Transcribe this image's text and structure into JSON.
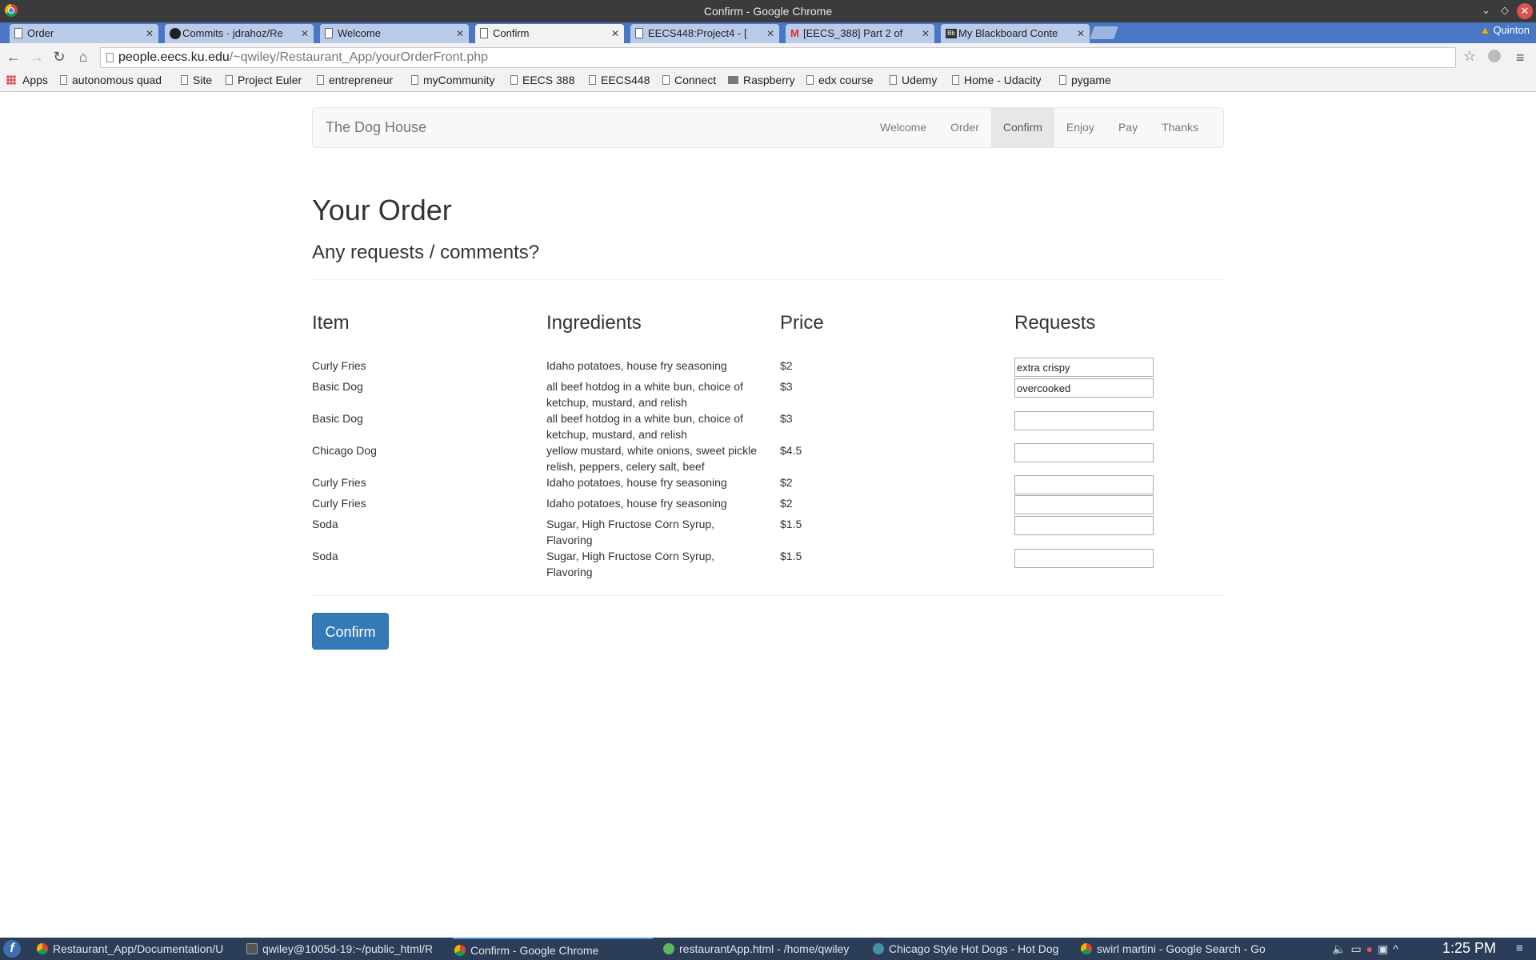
{
  "window": {
    "title": "Confirm - Google Chrome",
    "profile": "Quinton"
  },
  "tabs": [
    {
      "label": "Order",
      "icon": "page-icon",
      "active": false
    },
    {
      "label": "Commits · jdrahoz/Re",
      "icon": "github-icon",
      "active": false
    },
    {
      "label": "Welcome",
      "icon": "page-icon",
      "active": false
    },
    {
      "label": "Confirm",
      "icon": "page-icon",
      "active": true
    },
    {
      "label": "EECS448:Project4 - [",
      "icon": "page-icon",
      "active": false
    },
    {
      "label": "[EECS_388] Part 2 of",
      "icon": "gmail-icon",
      "active": false
    },
    {
      "label": "My Blackboard Conte",
      "icon": "blackboard-icon",
      "active": false
    }
  ],
  "address_bar": {
    "host": "people.eecs.ku.edu",
    "path": "/~qwiley/Restaurant_App/yourOrderFront.php"
  },
  "bookmarks": [
    {
      "label": "Apps",
      "icon": "apps-grid-icon"
    },
    {
      "label": "autonomous quad",
      "icon": "page-icon"
    },
    {
      "label": "Site",
      "icon": "page-icon"
    },
    {
      "label": "Project Euler",
      "icon": "page-icon"
    },
    {
      "label": "entrepreneur",
      "icon": "page-icon"
    },
    {
      "label": "myCommunity",
      "icon": "page-icon"
    },
    {
      "label": "EECS 388",
      "icon": "page-icon"
    },
    {
      "label": "EECS448",
      "icon": "page-icon"
    },
    {
      "label": "Connect",
      "icon": "page-icon"
    },
    {
      "label": "Raspberry",
      "icon": "folder-icon"
    },
    {
      "label": "edx course",
      "icon": "page-icon"
    },
    {
      "label": "Udemy",
      "icon": "page-icon"
    },
    {
      "label": "Home - Udacity",
      "icon": "page-icon"
    },
    {
      "label": "pygame",
      "icon": "page-icon"
    }
  ],
  "site": {
    "brand": "The Dog House",
    "nav": [
      "Welcome",
      "Order",
      "Confirm",
      "Enjoy",
      "Pay",
      "Thanks"
    ],
    "active_nav": "Confirm"
  },
  "page": {
    "title": "Your Order",
    "subtitle": "Any requests / comments?",
    "columns": [
      "Item",
      "Ingredients",
      "Price",
      "Requests"
    ],
    "rows": [
      {
        "item": "Curly Fries",
        "ingredients": "Idaho potatoes, house fry seasoning",
        "price": "$2",
        "request": "extra crispy"
      },
      {
        "item": "Basic Dog",
        "ingredients": "all beef hotdog in a white bun, choice of ketchup, mustard, and relish",
        "price": "$3",
        "request": "overcooked"
      },
      {
        "item": "Basic Dog",
        "ingredients": "all beef hotdog in a white bun, choice of ketchup, mustard, and relish",
        "price": "$3",
        "request": ""
      },
      {
        "item": "Chicago Dog",
        "ingredients": "yellow mustard, white onions, sweet pickle relish, peppers, celery salt, beef",
        "price": "$4.5",
        "request": ""
      },
      {
        "item": "Curly Fries",
        "ingredients": "Idaho potatoes, house fry seasoning",
        "price": "$2",
        "request": ""
      },
      {
        "item": "Curly Fries",
        "ingredients": "Idaho potatoes, house fry seasoning",
        "price": "$2",
        "request": ""
      },
      {
        "item": "Soda",
        "ingredients": "Sugar, High Fructose Corn Syrup, Flavoring",
        "price": "$1.5",
        "request": ""
      },
      {
        "item": "Soda",
        "ingredients": "Sugar, High Fructose Corn Syrup, Flavoring",
        "price": "$1.5",
        "request": ""
      }
    ],
    "confirm_label": "Confirm"
  },
  "taskbar": {
    "tasks": [
      {
        "label": "Restaurant_App/Documentation/U",
        "kind": "chrome"
      },
      {
        "label": "qwiley@1005d-19:~/public_html/R",
        "kind": "term"
      },
      {
        "label": "Confirm - Google Chrome",
        "kind": "chrome"
      },
      {
        "label": "restaurantApp.html - /home/qwiley",
        "kind": "editor"
      },
      {
        "label": "Chicago Style Hot Dogs - Hot Dog",
        "kind": "other"
      },
      {
        "label": "swirl martini - Google Search - Go",
        "kind": "chrome"
      }
    ],
    "clock": "1:25 PM"
  },
  "colors": {
    "tab_strip": "#4a77c4",
    "primary_button": "#337ab7",
    "taskbar": "#2c3e57"
  }
}
